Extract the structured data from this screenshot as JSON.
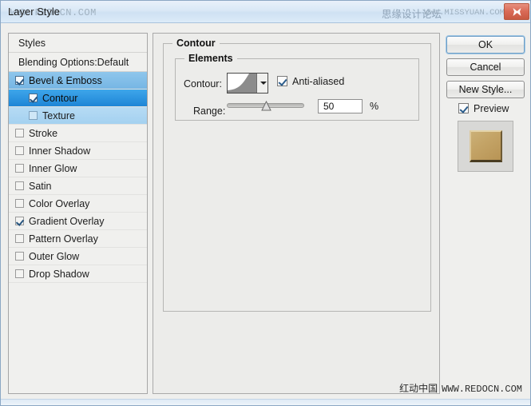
{
  "window": {
    "title": "Layer Style",
    "watermark_title": "WWW.REDOCN.COM",
    "watermark_cn": "思缘设计论坛",
    "watermark_site2": "WWW.MISSYUAN.COM",
    "close_icon": "close-icon"
  },
  "styles_panel": {
    "header": "Styles",
    "blending_options": "Blending Options:Default",
    "items": [
      {
        "label": "Bevel & Emboss",
        "checked": true,
        "state": "parent",
        "indent": 0
      },
      {
        "label": "Contour",
        "checked": true,
        "state": "active",
        "indent": 1
      },
      {
        "label": "Texture",
        "checked": false,
        "state": "child",
        "indent": 1
      },
      {
        "label": "Stroke",
        "checked": false,
        "state": "normal",
        "indent": 0
      },
      {
        "label": "Inner Shadow",
        "checked": false,
        "state": "normal",
        "indent": 0
      },
      {
        "label": "Inner Glow",
        "checked": false,
        "state": "normal",
        "indent": 0
      },
      {
        "label": "Satin",
        "checked": false,
        "state": "normal",
        "indent": 0
      },
      {
        "label": "Color Overlay",
        "checked": false,
        "state": "normal",
        "indent": 0
      },
      {
        "label": "Gradient Overlay",
        "checked": true,
        "state": "normal",
        "indent": 0
      },
      {
        "label": "Pattern Overlay",
        "checked": false,
        "state": "normal",
        "indent": 0
      },
      {
        "label": "Outer Glow",
        "checked": false,
        "state": "normal",
        "indent": 0
      },
      {
        "label": "Drop Shadow",
        "checked": false,
        "state": "normal",
        "indent": 0
      }
    ]
  },
  "main": {
    "group_title": "Contour",
    "elements_title": "Elements",
    "contour_label": "Contour:",
    "contour_preview_icon": "contour-curve-icon",
    "contour_dropdown_icon": "chevron-down-icon",
    "anti_aliased_label": "Anti-aliased",
    "anti_aliased_checked": true,
    "range_label": "Range:",
    "range_value": "50",
    "range_unit": "%",
    "range_min": 0,
    "range_max": 100
  },
  "buttons": {
    "ok": "OK",
    "cancel": "Cancel",
    "new_style": "New Style...",
    "preview_label": "Preview",
    "preview_checked": true
  },
  "footer": {
    "watermark_cn": "红动中国",
    "watermark_site": "WWW.REDOCN.COM"
  },
  "colors": {
    "accent_selected": "#1e85d6",
    "accent_parent": "#7ab8e8",
    "accent_child": "#a8d4f0",
    "titlebar": "#d9e8f6",
    "close_button": "#d96a56",
    "panel_bg": "#ececea",
    "preview_gold": "#c4a467"
  }
}
